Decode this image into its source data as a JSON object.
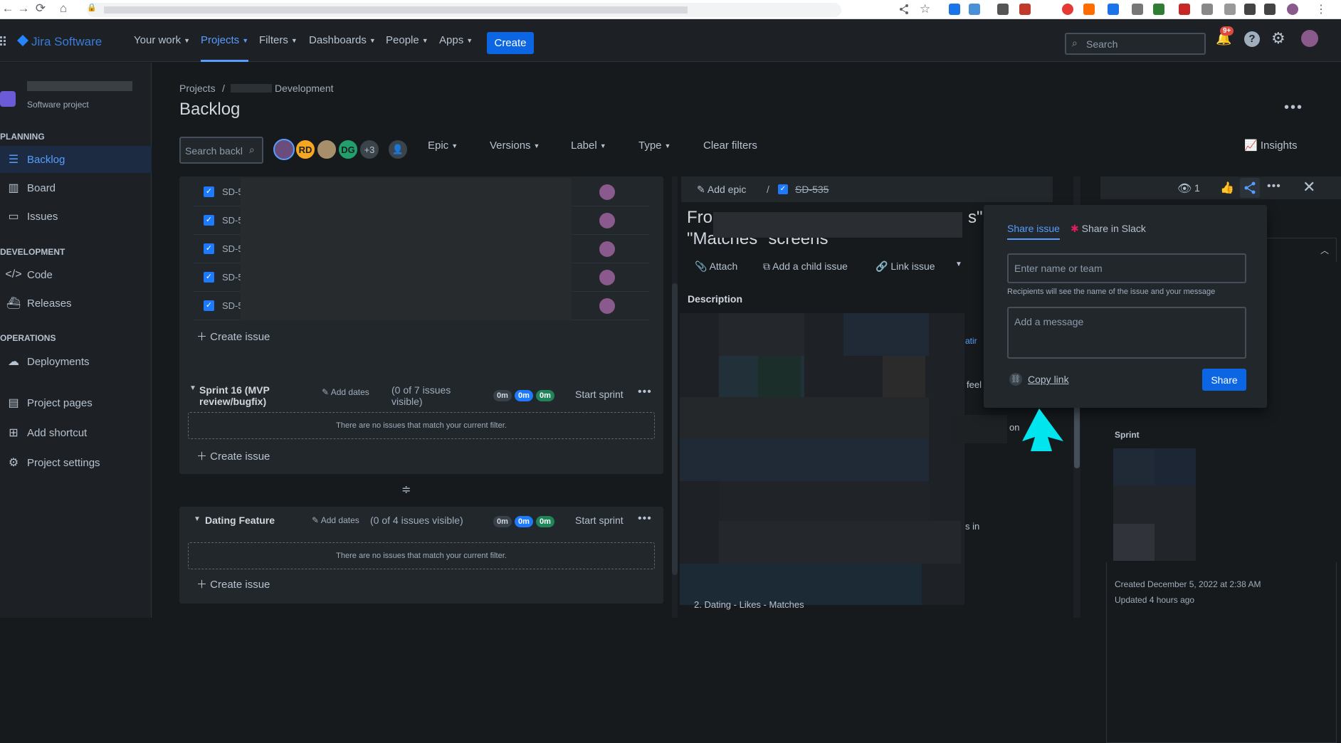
{
  "browser": {
    "nav_back": "←",
    "nav_forward": "→",
    "nav_reload": "⟳",
    "nav_home": "⌂",
    "lock": "🔒"
  },
  "topnav": {
    "logo": "Jira Software",
    "items": [
      {
        "label": "Your work"
      },
      {
        "label": "Projects"
      },
      {
        "label": "Filters"
      },
      {
        "label": "Dashboards"
      },
      {
        "label": "People"
      },
      {
        "label": "Apps"
      }
    ],
    "create_label": "Create",
    "search_placeholder": "Search",
    "notif_badge": "9+"
  },
  "sidebar": {
    "project_type": "Software project",
    "sections": {
      "planning": "PLANNING",
      "development": "DEVELOPMENT",
      "operations": "OPERATIONS"
    },
    "items": {
      "backlog": "Backlog",
      "board": "Board",
      "issues": "Issues",
      "code": "Code",
      "releases": "Releases",
      "deployments": "Deployments",
      "project_pages": "Project pages",
      "add_shortcut": "Add shortcut",
      "project_settings": "Project settings"
    }
  },
  "main": {
    "breadcrumb_projects": "Projects",
    "breadcrumb_sep": "/",
    "breadcrumb_project": "Development",
    "page_title": "Backlog",
    "search_placeholder": "Search backl",
    "avatars": [
      {
        "initials": "RD"
      },
      {
        "initials": "DG"
      },
      {
        "initials": "+3"
      }
    ],
    "filters": {
      "epic": "Epic",
      "versions": "Versions",
      "label": "Label",
      "type": "Type",
      "clear": "Clear filters"
    },
    "insights": "Insights"
  },
  "backlog": {
    "rows": [
      {
        "key": "SD-5"
      },
      {
        "key": "SD-5"
      },
      {
        "key": "SD-5"
      },
      {
        "key": "SD-5"
      },
      {
        "key": "SD-5"
      }
    ],
    "create_issue": "Create issue",
    "sprints": [
      {
        "name": "Sprint 16 (MVP review/bugfix)",
        "add_dates": "Add dates",
        "visible": "(0 of 7 issues visible)",
        "est": [
          "0m",
          "0m",
          "0m"
        ],
        "start": "Start sprint",
        "empty": "There are no issues that match your current filter."
      },
      {
        "name": "Dating Feature",
        "add_dates": "Add dates",
        "visible": "(0 of 4 issues visible)",
        "est": [
          "0m",
          "0m",
          "0m"
        ],
        "start": "Start sprint",
        "empty": "There are no issues that match your current filter."
      }
    ]
  },
  "detail": {
    "add_epic": "Add epic",
    "sep": "/",
    "issue_key": "SD-535",
    "title_line1": "Fro",
    "title_line1_tail": "s\"",
    "title_line2": "\"Matches\" screens",
    "actions": {
      "attach": "Attach",
      "child": "Add a child issue",
      "link": "Link issue"
    },
    "description_label": "Description",
    "frag_atir": "atir",
    "frag_feel": "feel",
    "frag_on": "on",
    "frag_sin": "s in",
    "bottom_line": "2. Dating - Likes - Matches"
  },
  "topright": {
    "watch_count": "1"
  },
  "share": {
    "tab_issue": "Share issue",
    "tab_slack": "Share in Slack",
    "name_placeholder": "Enter name or team",
    "hint": "Recipients will see the name of the issue and your message",
    "message_placeholder": "Add a message",
    "copy_link": "Copy link",
    "share_button": "Share"
  },
  "rightcol": {
    "sprint_label": "Sprint",
    "created": "Created December 5, 2022 at 2:38 AM",
    "updated": "Updated 4 hours ago"
  },
  "colors": {
    "accent": "#579dff",
    "primary_button": "#0c66e4",
    "arrow": "#00e5ee"
  }
}
